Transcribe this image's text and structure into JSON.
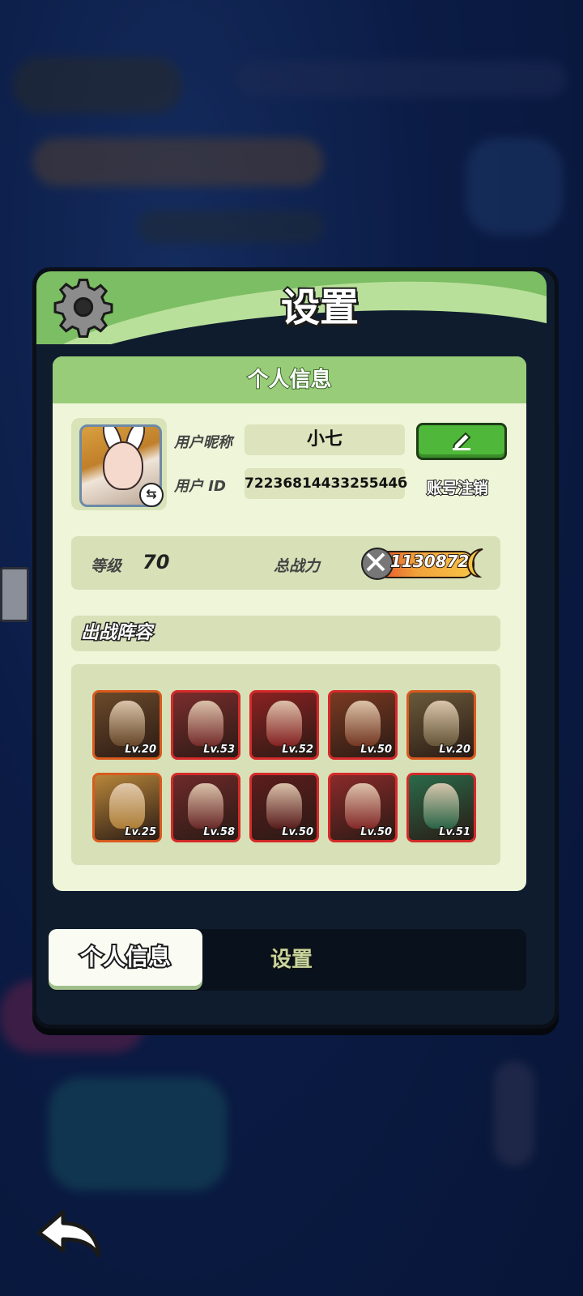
{
  "dialog": {
    "title": "设置",
    "section_title": "个人信息",
    "nickname_label": "用户昵称",
    "nickname_value": "小七",
    "id_label": "用户 ID",
    "id_value": "7223681443325544б",
    "cancel_account": "账号注销",
    "level_label": "等级",
    "level_value": "70",
    "power_label": "总战力",
    "power_value": "1130872",
    "team_title": "出战阵容"
  },
  "heroes": [
    {
      "lv": "Lv.20",
      "rarity": "orange",
      "color": "#6b4a2a"
    },
    {
      "lv": "Lv.53",
      "rarity": "red",
      "color": "#7a2d2d"
    },
    {
      "lv": "Lv.52",
      "rarity": "red",
      "color": "#8a2222"
    },
    {
      "lv": "Lv.50",
      "rarity": "red",
      "color": "#7a3a22"
    },
    {
      "lv": "Lv.20",
      "rarity": "orange",
      "color": "#6a5a3a"
    },
    {
      "lv": "Lv.25",
      "rarity": "orange",
      "color": "#b8863a"
    },
    {
      "lv": "Lv.58",
      "rarity": "red",
      "color": "#6e2a2a"
    },
    {
      "lv": "Lv.50",
      "rarity": "red",
      "color": "#5c1d1d"
    },
    {
      "lv": "Lv.50",
      "rarity": "red",
      "color": "#8a2a2a"
    },
    {
      "lv": "Lv.51",
      "rarity": "red",
      "color": "#2a6a4a"
    }
  ],
  "tabs": [
    "个人信息",
    "设置"
  ],
  "icons": {
    "gear": "gear-icon",
    "edit": "pencil-icon",
    "swap": "swap-icon",
    "power": "crossed-swords-icon",
    "back": "back-arrow-icon"
  },
  "colors": {
    "header_green": "#7cbe63",
    "card_bg": "#eef5d8",
    "edit_button": "#4fb83a",
    "panel_dark": "#0f1c2e"
  }
}
